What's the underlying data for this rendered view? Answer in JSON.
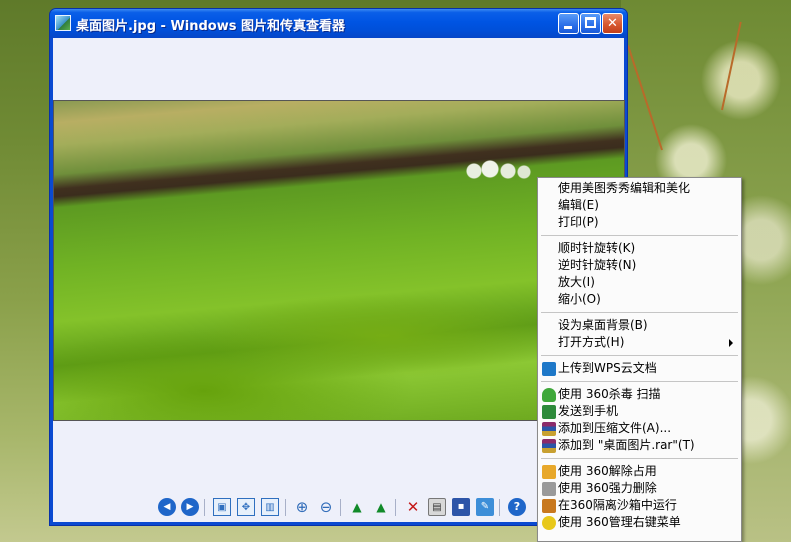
{
  "window": {
    "title": "桌面图片.jpg - Windows 图片和传真查看器",
    "min_glyph": "",
    "max_glyph": "",
    "close_glyph": "✕"
  },
  "toolbar": {
    "icons": [
      "previous-image-icon",
      "next-image-icon",
      "best-fit-icon",
      "actual-size-icon",
      "slideshow-icon",
      "zoom-in-icon",
      "zoom-out-icon",
      "rotate-clockwise-icon",
      "rotate-counterclockwise-icon",
      "delete-icon",
      "print-icon",
      "save-icon",
      "open-editor-icon",
      "help-icon"
    ],
    "prev": "◀",
    "next": "▶",
    "best_fit": "▣",
    "actual": "✥",
    "slideshow": "▥",
    "zoom_in": "⊕",
    "zoom_out": "⊖",
    "rot_cw": "▲",
    "rot_ccw": "▲",
    "delete": "✕",
    "print": "▤",
    "save": "▪",
    "editor": "✎",
    "help": "?"
  },
  "context_menu": {
    "items": [
      {
        "label": "使用美图秀秀编辑和美化"
      },
      {
        "label": "编辑(E)"
      },
      {
        "label": "打印(P)"
      },
      {
        "label": "顺时针旋转(K)"
      },
      {
        "label": "逆时针旋转(N)"
      },
      {
        "label": "放大(I)"
      },
      {
        "label": "缩小(O)"
      },
      {
        "label": "设为桌面背景(B)"
      },
      {
        "label": "打开方式(H)"
      },
      {
        "label": "上传到WPS云文档",
        "icon": "wps-cloud-icon"
      },
      {
        "label": "使用 360杀毒 扫描",
        "icon": "360-antivirus-icon"
      },
      {
        "label": "发送到手机",
        "icon": "send-to-phone-icon"
      },
      {
        "label": "添加到压缩文件(A)...",
        "icon": "winrar-icon"
      },
      {
        "label": "添加到 \"桌面图片.rar\"(T)",
        "icon": "winrar-icon"
      },
      {
        "label": "使用 360解除占用",
        "icon": "360-unlock-icon"
      },
      {
        "label": "使用 360强力删除",
        "icon": "360-shred-icon"
      },
      {
        "label": "在360隔离沙箱中运行",
        "icon": "360-sandbox-icon"
      },
      {
        "label": "使用 360管理右键菜单",
        "icon": "360-menu-manager-icon"
      }
    ],
    "submenu_arrow_color": "#000000"
  },
  "colors": {
    "title_bar": "#0054e3",
    "window_client": "#eef0fa",
    "menu_bg": "#fbfbfb"
  }
}
